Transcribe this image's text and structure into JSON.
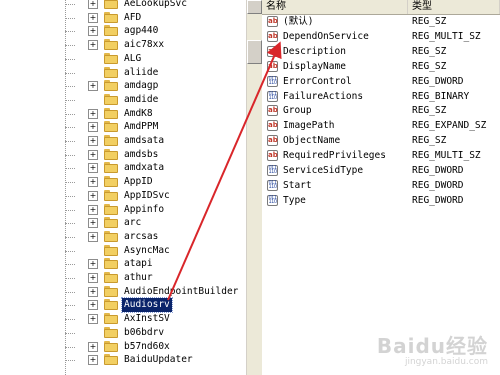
{
  "tree": {
    "items": [
      {
        "label": "AeLookupSvc",
        "expander": "+"
      },
      {
        "label": "AFD",
        "expander": "+"
      },
      {
        "label": "agp440",
        "expander": "+"
      },
      {
        "label": "aic78xx",
        "expander": "+"
      },
      {
        "label": "ALG",
        "expander": ""
      },
      {
        "label": "aliide",
        "expander": ""
      },
      {
        "label": "amdagp",
        "expander": "+"
      },
      {
        "label": "amdide",
        "expander": ""
      },
      {
        "label": "AmdK8",
        "expander": "+"
      },
      {
        "label": "AmdPPM",
        "expander": "+"
      },
      {
        "label": "amdsata",
        "expander": "+"
      },
      {
        "label": "amdsbs",
        "expander": "+"
      },
      {
        "label": "amdxata",
        "expander": "+"
      },
      {
        "label": "AppID",
        "expander": "+"
      },
      {
        "label": "AppIDSvc",
        "expander": "+"
      },
      {
        "label": "Appinfo",
        "expander": "+"
      },
      {
        "label": "arc",
        "expander": "+"
      },
      {
        "label": "arcsas",
        "expander": "+"
      },
      {
        "label": "AsyncMac",
        "expander": ""
      },
      {
        "label": "atapi",
        "expander": "+"
      },
      {
        "label": "athur",
        "expander": "+"
      },
      {
        "label": "AudioEndpointBuilder",
        "expander": "+"
      },
      {
        "label": "Audiosrv",
        "expander": "+",
        "selected": true
      },
      {
        "label": "AxInstSV",
        "expander": "+"
      },
      {
        "label": "b06bdrv",
        "expander": ""
      },
      {
        "label": "b57nd60x",
        "expander": "+"
      },
      {
        "label": "BaiduUpdater",
        "expander": "+"
      }
    ]
  },
  "list": {
    "col_name": "名称",
    "col_type": "类型",
    "rows": [
      {
        "name": "(默认)",
        "type": "REG_SZ",
        "icon": "ab"
      },
      {
        "name": "DependOnService",
        "type": "REG_MULTI_SZ",
        "icon": "ab"
      },
      {
        "name": "Description",
        "type": "REG_SZ",
        "icon": "ab"
      },
      {
        "name": "DisplayName",
        "type": "REG_SZ",
        "icon": "ab"
      },
      {
        "name": "ErrorControl",
        "type": "REG_DWORD",
        "icon": "bin"
      },
      {
        "name": "FailureActions",
        "type": "REG_BINARY",
        "icon": "bin"
      },
      {
        "name": "Group",
        "type": "REG_SZ",
        "icon": "ab"
      },
      {
        "name": "ImagePath",
        "type": "REG_EXPAND_SZ",
        "icon": "ab"
      },
      {
        "name": "ObjectName",
        "type": "REG_SZ",
        "icon": "ab"
      },
      {
        "name": "RequiredPrivileges",
        "type": "REG_MULTI_SZ",
        "icon": "ab"
      },
      {
        "name": "ServiceSidType",
        "type": "REG_DWORD",
        "icon": "bin"
      },
      {
        "name": "Start",
        "type": "REG_DWORD",
        "icon": "bin"
      },
      {
        "name": "Type",
        "type": "REG_DWORD",
        "icon": "bin"
      }
    ]
  },
  "icons": {
    "ab": "ab",
    "bin": "011\n110"
  },
  "watermark": {
    "logo": "Baidu经验",
    "url": "jingyan.baidu.com"
  },
  "colors": {
    "selection": "#0a246a",
    "arrow": "#d9262a",
    "folder": "#f2cf62"
  }
}
